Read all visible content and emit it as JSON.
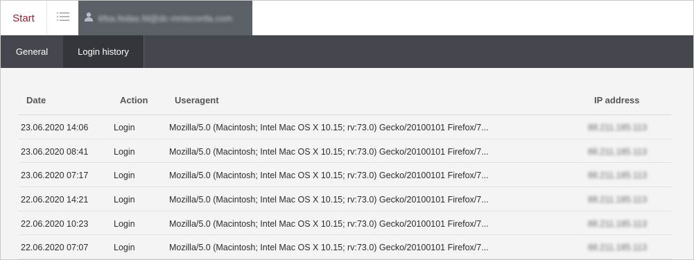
{
  "header": {
    "start_label": "Start",
    "user_email": "kfsa.fedas.fd@dc-mnleconfa.com"
  },
  "tabs": [
    {
      "label": "General"
    },
    {
      "label": "Login history"
    }
  ],
  "table": {
    "columns": {
      "date": "Date",
      "action": "Action",
      "useragent": "Useragent",
      "ip": "IP address"
    },
    "rows": [
      {
        "date": "23.06.2020 14:06",
        "action": "Login",
        "useragent": "Mozilla/5.0 (Macintosh; Intel Mac OS X 10.15; rv:73.0) Gecko/20100101 Firefox/7...",
        "ip": "88.211.185.113"
      },
      {
        "date": "23.06.2020 08:41",
        "action": "Login",
        "useragent": "Mozilla/5.0 (Macintosh; Intel Mac OS X 10.15; rv:73.0) Gecko/20100101 Firefox/7...",
        "ip": "88.211.185.113"
      },
      {
        "date": "23.06.2020 07:17",
        "action": "Login",
        "useragent": "Mozilla/5.0 (Macintosh; Intel Mac OS X 10.15; rv:73.0) Gecko/20100101 Firefox/7...",
        "ip": "88.211.185.113"
      },
      {
        "date": "22.06.2020 14:21",
        "action": "Login",
        "useragent": "Mozilla/5.0 (Macintosh; Intel Mac OS X 10.15; rv:73.0) Gecko/20100101 Firefox/7...",
        "ip": "88.211.185.113"
      },
      {
        "date": "22.06.2020 10:23",
        "action": "Login",
        "useragent": "Mozilla/5.0 (Macintosh; Intel Mac OS X 10.15; rv:73.0) Gecko/20100101 Firefox/7...",
        "ip": "88.211.185.113"
      },
      {
        "date": "22.06.2020 07:07",
        "action": "Login",
        "useragent": "Mozilla/5.0 (Macintosh; Intel Mac OS X 10.15; rv:73.0) Gecko/20100101 Firefox/7...",
        "ip": "88.211.185.113"
      }
    ]
  },
  "icons": {
    "menu": "list-icon",
    "user": "user-icon"
  },
  "colors": {
    "accent": "#8a2230",
    "nav_bg": "#43464c",
    "active_tab_bg": "#33363b",
    "user_tab_bg": "#5b5f66"
  }
}
